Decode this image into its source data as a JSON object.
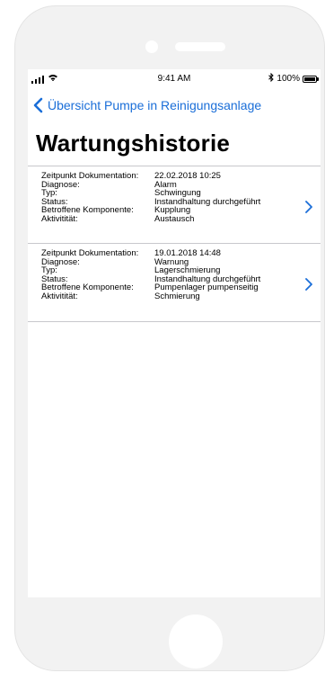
{
  "status_bar": {
    "time": "9:41 AM",
    "battery_percent": "100%",
    "bluetooth_icon": "bluetooth-icon",
    "wifi_icon": "wifi-icon"
  },
  "nav": {
    "back_label": "Übersicht Pumpe in Reinigungsanlage"
  },
  "page": {
    "title": "Wartungshistorie"
  },
  "labels": {
    "zeitpunkt": "Zeitpunkt Dokumentation:",
    "diagnose": "Diagnose:",
    "typ": "Typ:",
    "status": "Status:",
    "komponente": "Betroffene Komponente:",
    "aktivitaet": "Aktivitität:"
  },
  "entries": [
    {
      "zeitpunkt": "22.02.2018 10:25",
      "diagnose": "Alarm",
      "typ": "Schwingung",
      "status": "Instandhaltung durchgeführt",
      "komponente": "Kupplung",
      "aktivitaet": "Austausch"
    },
    {
      "zeitpunkt": "19.01.2018 14:48",
      "diagnose": "Warnung",
      "typ": "Lagerschmierung",
      "status": "Instandhaltung durchgeführt",
      "komponente": "Pumpenlager pumpenseitig",
      "aktivitaet": "Schmierung"
    }
  ],
  "colors": {
    "accent": "#1a6ed8",
    "divider": "#c8c8cc",
    "device": "#f2f2f2"
  }
}
